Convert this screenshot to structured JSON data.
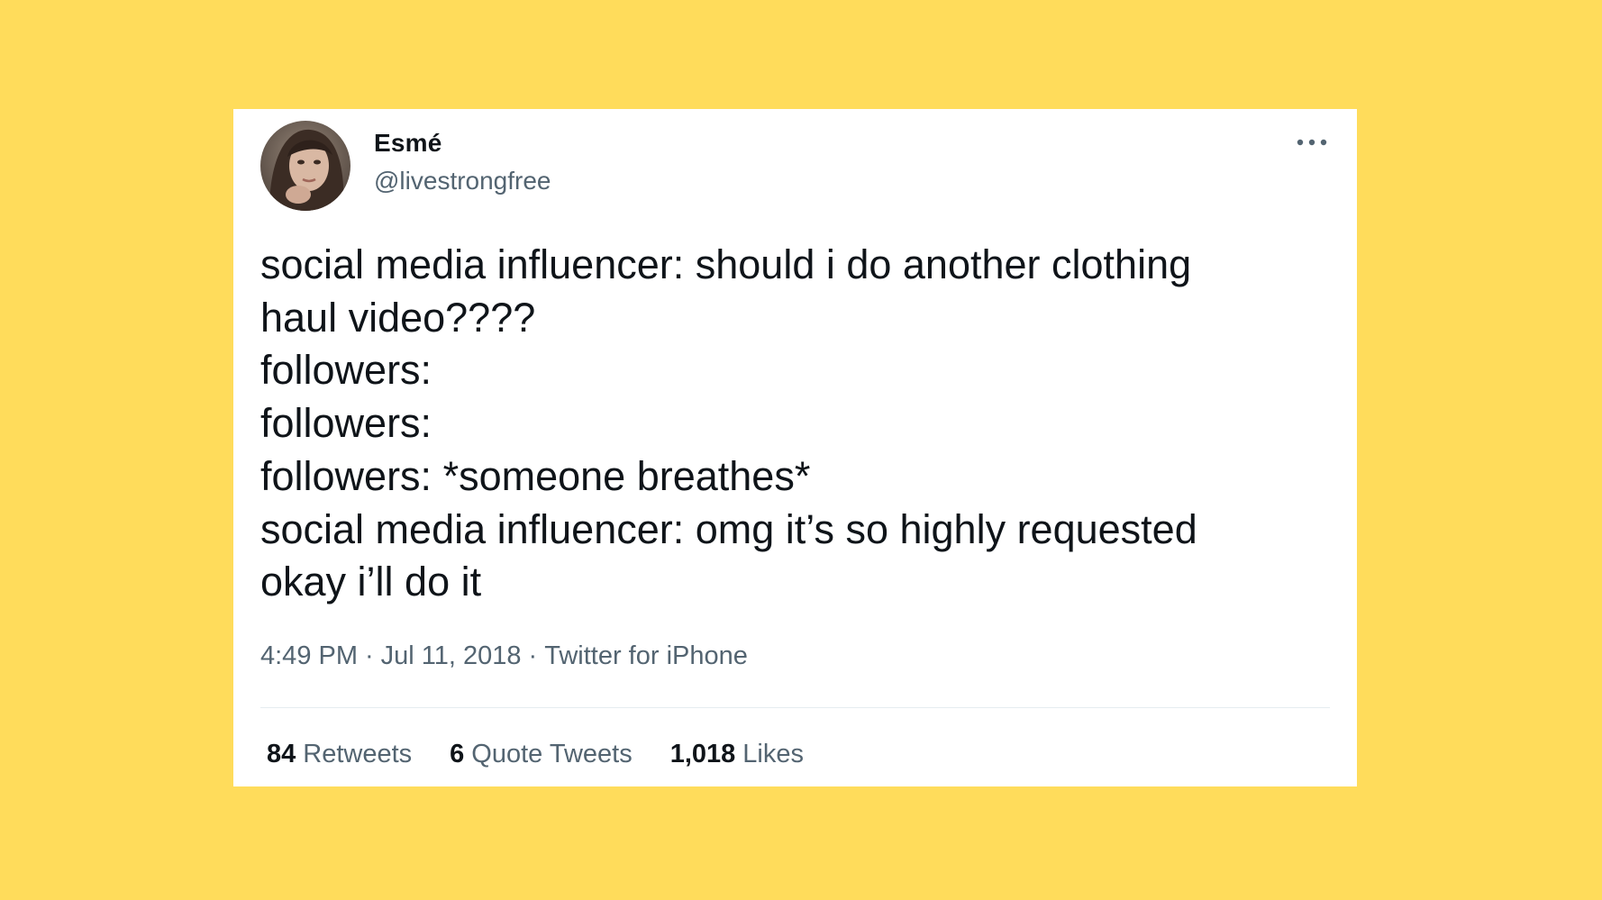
{
  "background_color": "#FFDC5B",
  "tweet": {
    "author": {
      "display_name": "Esmé",
      "handle": "@livestrongfree",
      "avatar_icon": "user-avatar-photo"
    },
    "more_icon": "more-horizontal-icon",
    "text_lines": [
      "social media influencer: should i do another clothing",
      "haul video????",
      "followers:",
      "followers:",
      "followers: *someone breathes*",
      "social media influencer: omg it’s so highly requested",
      "okay i’ll do it"
    ],
    "time": "4:49 PM",
    "date": "Jul 11, 2018",
    "source": "Twitter for iPhone",
    "separator": "·",
    "stats": {
      "retweets_count": "84",
      "retweets_label": "Retweets",
      "quotes_count": "6",
      "quotes_label": "Quote Tweets",
      "likes_count": "1,018",
      "likes_label": "Likes"
    }
  }
}
